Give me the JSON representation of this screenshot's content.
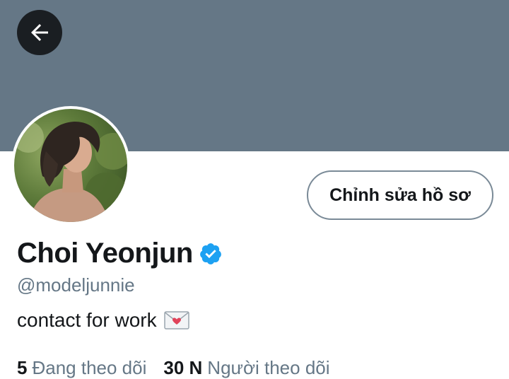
{
  "header": {
    "back_icon": "arrow-left-icon",
    "banner_color": "#657786"
  },
  "profile": {
    "avatar_description": "avatar",
    "edit_button_label": "Chỉnh sửa hồ sơ",
    "display_name": "Choi Yeonjun",
    "verified_icon": "verified-badge-icon",
    "verified_color": "#1da1f2",
    "handle": "@modeljunnie",
    "bio_text": "contact for work",
    "bio_emoji_icon": "love-letter-icon",
    "following_count": "5",
    "following_label": "Đang theo dõi",
    "followers_count": "30 N",
    "followers_label": "Người theo dõi"
  },
  "colors": {
    "text_primary": "#14171a",
    "text_secondary": "#657786"
  }
}
